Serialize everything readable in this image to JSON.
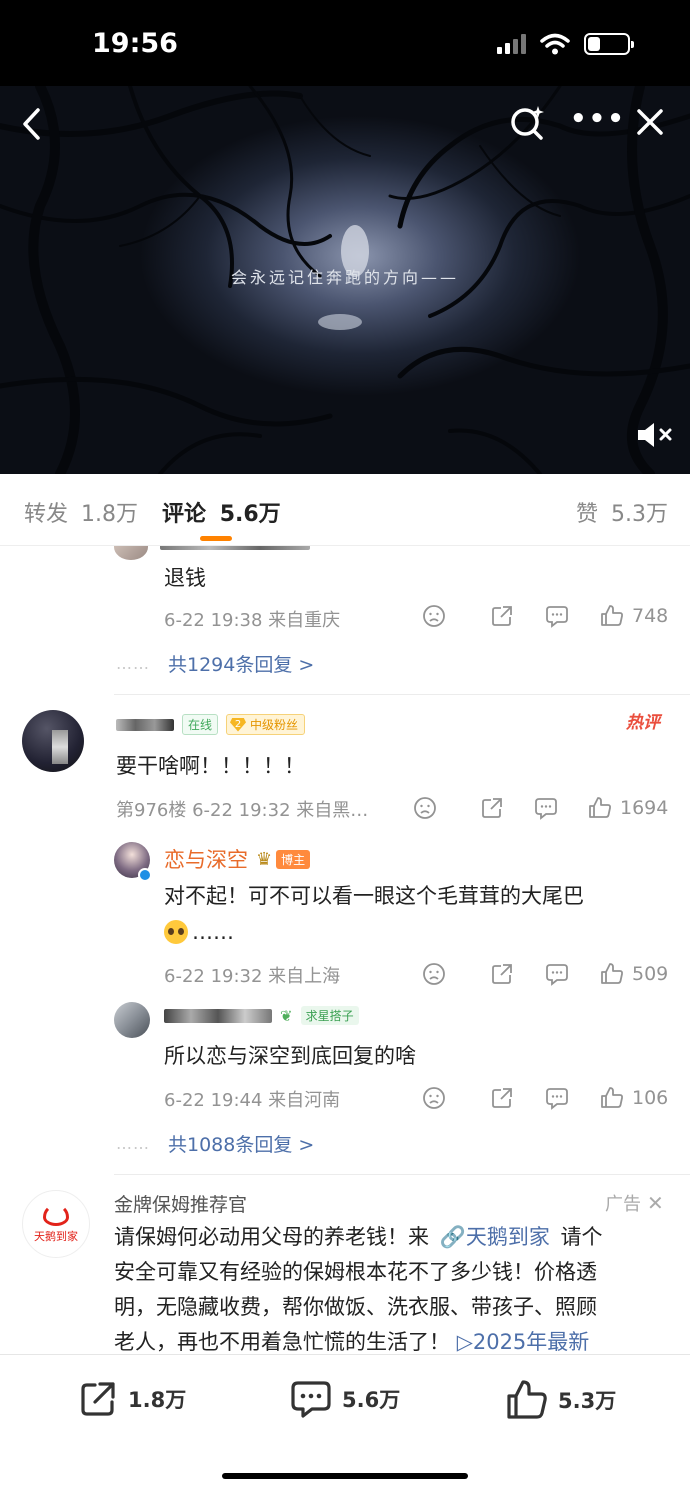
{
  "status_bar": {
    "time": "19:56"
  },
  "video": {
    "caption": "会永远记住奔跑的方向——"
  },
  "tabs": [
    {
      "label": "转发",
      "count": "1.8万"
    },
    {
      "label": "评论",
      "count": "5.6万"
    },
    {
      "label": "赞",
      "count": "5.3万"
    }
  ],
  "comment1_tail": {
    "text": "退钱",
    "meta": "6-22 19:38 来自重庆",
    "likes": "748",
    "more_replies": "共1294条回复 >"
  },
  "comment2": {
    "online_badge": "在线",
    "fan_level": "2",
    "fan_badge": "中级粉丝",
    "hot_badge": "热评",
    "text": "要干啥啊！！！！！",
    "meta": "第976楼 6-22 19:32 来自黑…",
    "likes": "1694",
    "replies": [
      {
        "username": "恋与深空",
        "role_badge": "博主",
        "text": "对不起！可不可以看一眼这个毛茸茸的大尾巴",
        "text_suffix": "……",
        "meta": "6-22 19:32 来自上海",
        "likes": "509"
      },
      {
        "badge": "求星搭子",
        "text": "所以恋与深空到底回复的啥",
        "meta": "6-22 19:44 来自河南",
        "likes": "106"
      }
    ],
    "more_replies": "共1088条回复 >"
  },
  "ad": {
    "logo_text": "天鹅到家",
    "title": "金牌保姆推荐官",
    "tag": "广告",
    "line1_a": "请保姆何必动用父母的养老钱！来",
    "link": "天鹅到家",
    "line1_b": "请个",
    "line2": "安全可靠又有经验的保姆根本花不了多少钱！价格透",
    "line3": "明，无隐藏收费，帮你做饭、洗衣服、带孩子、照顾",
    "line4": "老人，再也不用着急忙慌的生活了！",
    "line4_link": "2025年最新"
  },
  "bottom_bar": {
    "repost": "1.8万",
    "comment": "5.6万",
    "like": "5.3万"
  },
  "colors": {
    "accent": "#ff8200",
    "link": "#4d6fa9",
    "blogger_name": "#e86b2a",
    "hot_badge": "#ea4e3d",
    "online_badge": "#40a95b"
  }
}
